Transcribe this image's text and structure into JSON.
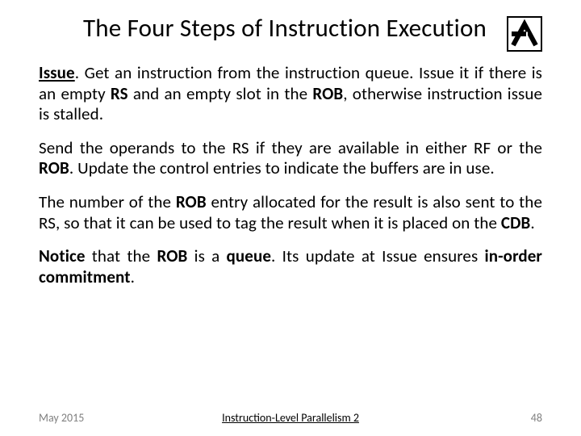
{
  "title": "The Four Steps of Instruction Execution",
  "p1": {
    "lead_u_b": "Issue",
    "t1": ". Get an instruction from the instruction queue. Issue it if there is an empty ",
    "rs": "RS",
    "t2": " and an empty slot in the ",
    "rob": "ROB",
    "t3": ", otherwise instruction issue is stalled."
  },
  "p2": {
    "t1": "Send the operands to the RS if they are available in either RF or the ",
    "rob": "ROB",
    "t2": ". Update the control entries to indicate the buffers are in use."
  },
  "p3": {
    "t1": "The number of the ",
    "rob": "ROB",
    "t2": " entry allocated for the result is also sent to the RS, so that it can be used to tag the result when it is placed on the ",
    "cdb": "CDB",
    "t3": "."
  },
  "p4": {
    "notice": "Notice",
    "t1": " that the ",
    "rob": "ROB",
    "t2": " is a ",
    "queue": "queue",
    "t3": ". Its update at Issue ensures ",
    "inorder": "in-order commitment",
    "t4": "."
  },
  "footer": {
    "left": "May 2015",
    "center": "Instruction-Level Parallelism 2",
    "right": "48"
  }
}
